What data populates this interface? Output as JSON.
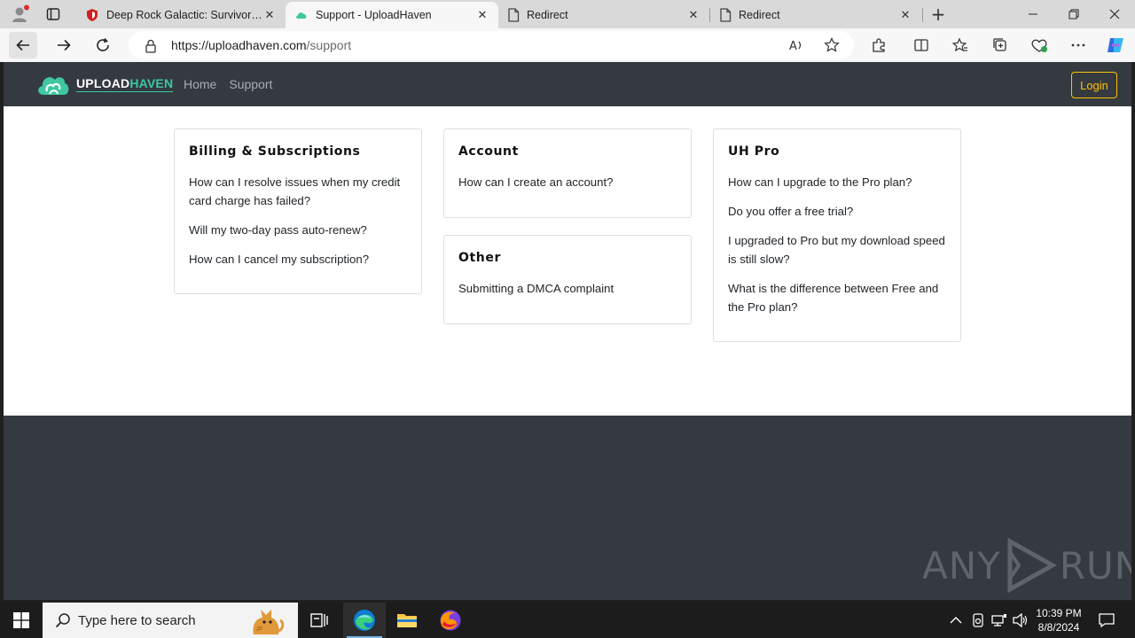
{
  "browser": {
    "tabs": [
      {
        "title": "Deep Rock Galactic: Survivor Free",
        "icon": "red-shield-icon",
        "active": false
      },
      {
        "title": "Support - UploadHaven",
        "icon": "uploadhaven-icon",
        "active": true
      },
      {
        "title": "Redirect",
        "icon": "page-icon",
        "active": false
      },
      {
        "title": "Redirect",
        "icon": "page-icon",
        "active": false
      }
    ],
    "address": {
      "url_host": "https://uploadhaven.com",
      "url_path": "/support"
    }
  },
  "site": {
    "logo": {
      "part1": "UPLOAD",
      "part2": "HAVEN"
    },
    "nav": {
      "home": "Home",
      "support": "Support"
    },
    "login_label": "Login",
    "brand_color": "#3ec7a0",
    "accent_color": "#ffc107",
    "nav_bg": "#343a40"
  },
  "support": {
    "sections": [
      {
        "title": "Billing & Subscriptions",
        "items": [
          "How can I resolve issues when my credit card charge has failed?",
          "Will my two-day pass auto-renew?",
          "How can I cancel my subscription?"
        ]
      },
      {
        "title": "Account",
        "items": [
          "How can I create an account?"
        ]
      },
      {
        "title": "Other",
        "items": [
          "Submitting a DMCA complaint"
        ]
      },
      {
        "title": "UH Pro",
        "items": [
          "How can I upgrade to the Pro plan?",
          "Do you offer a free trial?",
          "I upgraded to Pro but my download speed is still slow?",
          "What is the difference between Free and the Pro plan?"
        ]
      }
    ]
  },
  "watermark": {
    "left": "ANY",
    "right": "RUN"
  },
  "taskbar": {
    "search_placeholder": "Type here to search",
    "time": "10:39 PM",
    "date": "8/8/2024"
  }
}
